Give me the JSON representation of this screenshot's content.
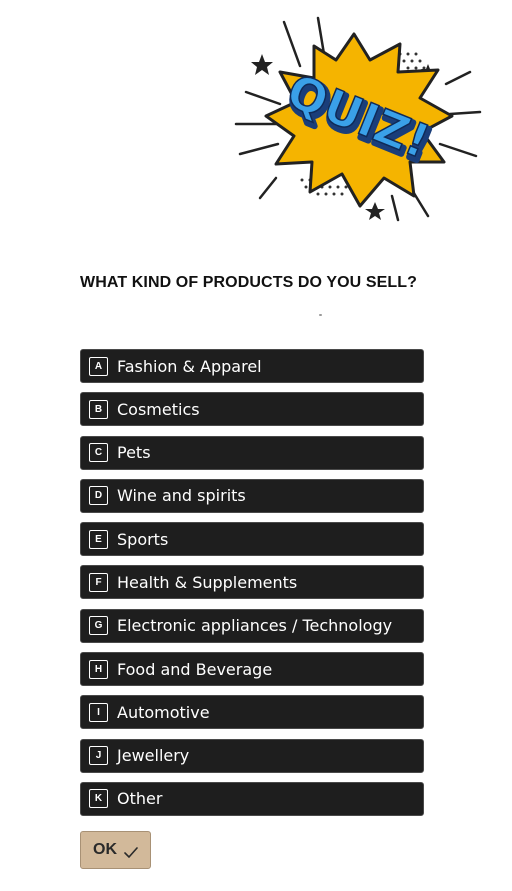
{
  "banner": {
    "word": "QUIZ!",
    "colors": {
      "burst": "#f5b400",
      "text": "#3aa0e8",
      "text_outline": "#1a3e7a",
      "ink": "#222222"
    }
  },
  "question": {
    "text": "WHAT KIND OF PRODUCTS DO YOU SELL?"
  },
  "options": [
    {
      "key": "A",
      "label": "Fashion & Apparel"
    },
    {
      "key": "B",
      "label": "Cosmetics"
    },
    {
      "key": "C",
      "label": "Pets"
    },
    {
      "key": "D",
      "label": "Wine and spirits"
    },
    {
      "key": "E",
      "label": "Sports"
    },
    {
      "key": "F",
      "label": "Health & Supplements"
    },
    {
      "key": "G",
      "label": "Electronic appliances / Technology"
    },
    {
      "key": "H",
      "label": "Food and Beverage"
    },
    {
      "key": "I",
      "label": "Automotive"
    },
    {
      "key": "J",
      "label": "Jewellery"
    },
    {
      "key": "K",
      "label": "Other"
    }
  ],
  "ok_button": {
    "label": "OK",
    "icon": "check-icon",
    "color": "#d2b99a"
  }
}
